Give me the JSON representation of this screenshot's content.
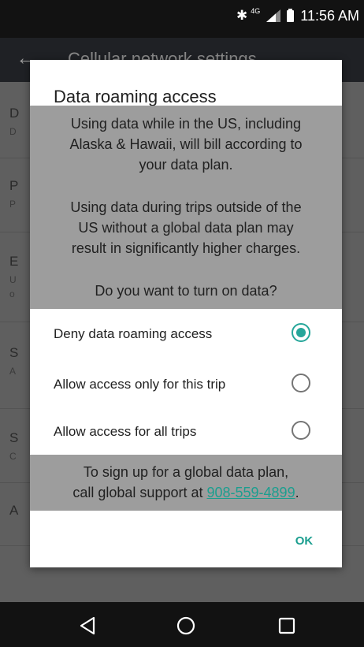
{
  "status_bar": {
    "network_type": "4G",
    "time": "11:56 AM",
    "icons": [
      "bluetooth-icon",
      "signal-icon",
      "battery-icon"
    ]
  },
  "app_bar": {
    "title": "Cellular network settings",
    "back_icon": "arrow-left-icon"
  },
  "background_list": {
    "items": [
      {
        "title_initial": "D",
        "subtitle_initial": "D"
      },
      {
        "title_initial": "P",
        "subtitle_initial": "P"
      },
      {
        "title_initial": "E",
        "subtitle_initial": "U",
        "subtitle2_initial": "o"
      },
      {
        "title_initial": "S",
        "subtitle_initial": "A"
      },
      {
        "title_initial": "S",
        "subtitle_initial": "C"
      },
      {
        "title_initial": "A"
      }
    ]
  },
  "dialog": {
    "title": "Data roaming access",
    "message_lines_1": [
      "Using data while in the US, including",
      "Alaska & Hawaii, will bill according to",
      "your data plan."
    ],
    "message_lines_2": [
      "Using data during trips outside of the",
      "US without a global data plan may",
      "result in significantly higher charges."
    ],
    "question": "Do you want to turn on data?",
    "options": [
      {
        "label": "Deny data roaming access",
        "selected": true
      },
      {
        "label": "Allow access only for this trip",
        "selected": false
      },
      {
        "label": "Allow access for all trips",
        "selected": false
      }
    ],
    "footer_line_1": "To sign up for a global data plan,",
    "footer_line_2_prefix": "call global support at ",
    "footer_phone": "908-559-4899",
    "footer_line_2_suffix": ".",
    "ok_label": "OK"
  },
  "colors": {
    "accent": "#26a69a",
    "link": "#1b9e8f",
    "highlight_bg": "#9d9d9d"
  },
  "nav_bar": {
    "buttons": [
      "back-triangle-icon",
      "home-circle-icon",
      "recents-square-icon"
    ]
  }
}
